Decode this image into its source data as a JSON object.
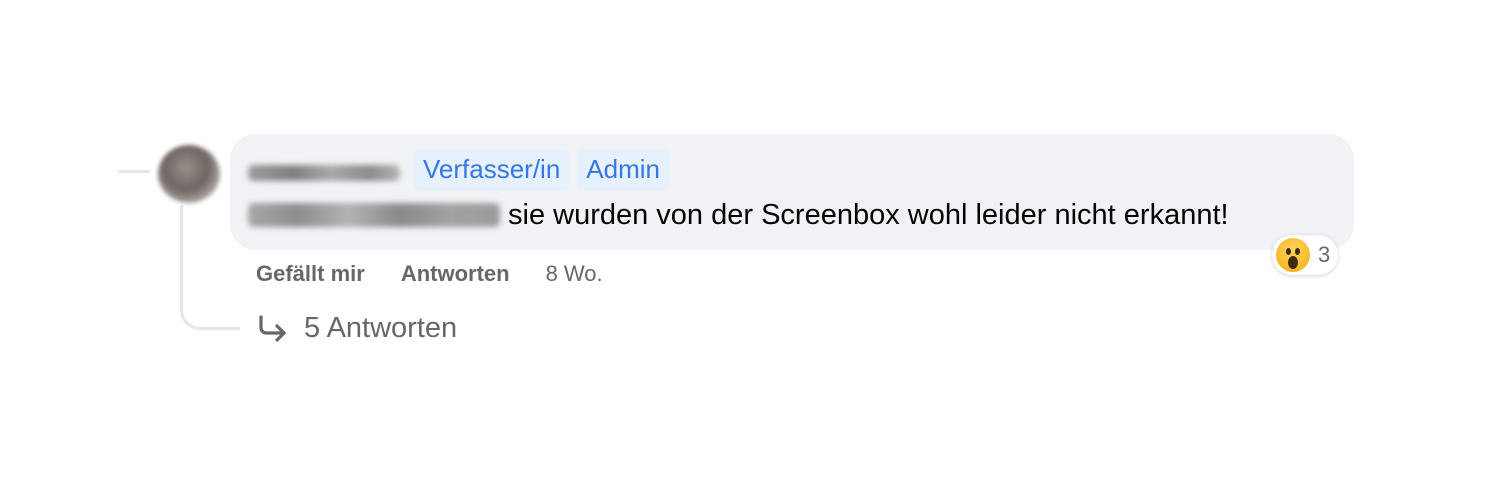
{
  "comment": {
    "badges": [
      "Verfasser/in",
      "Admin"
    ],
    "text": "sie wurden von der Screenbox wohl leider nicht erkannt!",
    "reaction": {
      "icon": "wow-emoji-icon",
      "count": "3"
    }
  },
  "actions": {
    "like_label": "Gefällt mir",
    "reply_label": "Antworten",
    "timestamp": "8 Wo."
  },
  "replies": {
    "icon": "reply-arrow-icon",
    "label": "5 Antworten"
  },
  "colors": {
    "bubble_bg": "#f0f2f5",
    "badge_bg": "#e7f0fd",
    "badge_text": "#3578e5",
    "secondary_text": "#65676b",
    "primary_text": "#050505"
  }
}
